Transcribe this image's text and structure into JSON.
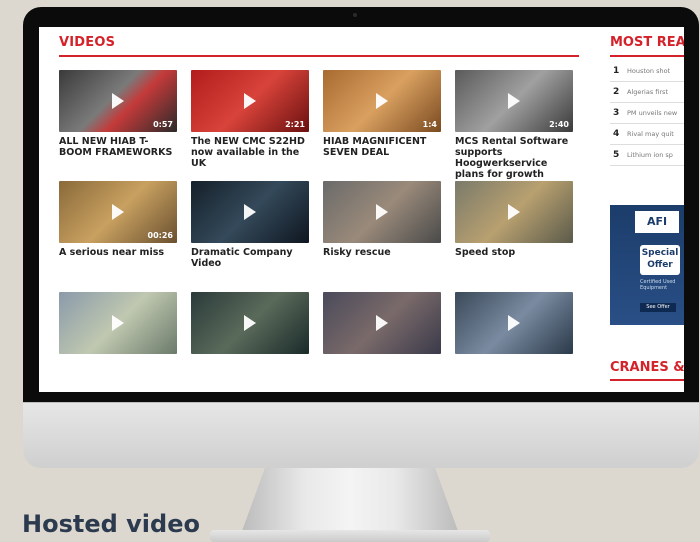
{
  "videos": {
    "title": "VIDEOS",
    "items": [
      {
        "caption": "ALL NEW HIAB T-BOOM FRAMEWORKS",
        "duration": "0:57",
        "bg": "linear-gradient(135deg,#3a3a3a,#7a7a7a 45%,#c43a3a 60%,#2a2a2a)"
      },
      {
        "caption": "The NEW CMC S22HD now available in the UK",
        "duration": "2:21",
        "bg": "linear-gradient(135deg,#b21c1c,#d8433a 50%,#6a1010)"
      },
      {
        "caption": "HIAB MAGNIFICENT SEVEN DEAL",
        "duration": "1:4",
        "bg": "linear-gradient(135deg,#a86a30,#d9a060 50%,#7a4a20)"
      },
      {
        "caption": "MCS Rental Software supports Hoogwerkservice plans for growth",
        "duration": "2:40",
        "bg": "linear-gradient(135deg,#5a5a5a,#a0a0a0 50%,#3a3a3a)"
      },
      {
        "caption": "A serious near miss",
        "duration": "00:26",
        "bg": "linear-gradient(135deg,#8a6a3a,#c8a060 50%,#6a5030)"
      },
      {
        "caption": "Dramatic Company Video",
        "duration": "",
        "bg": "linear-gradient(135deg,#15202a,#34495a 50%,#0e1620)"
      },
      {
        "caption": "Risky rescue",
        "duration": "",
        "bg": "linear-gradient(135deg,#6a6a6a,#9a8a7a 50%,#4a4a4a)"
      },
      {
        "caption": "Speed stop",
        "duration": "",
        "bg": "linear-gradient(135deg,#7a7a6a,#b8a070 50%,#5a5a4a)"
      },
      {
        "caption": "",
        "duration": "",
        "bg": "linear-gradient(135deg,#8a9aaa,#c0c8b0 50%,#6a7a6a)"
      },
      {
        "caption": "",
        "duration": "",
        "bg": "linear-gradient(135deg,#2a3a3a,#5a6a5a 50%,#1a2a2a)"
      },
      {
        "caption": "",
        "duration": "",
        "bg": "linear-gradient(135deg,#4a4a5a,#7a6a6a 50%,#3a3a4a)"
      },
      {
        "caption": "",
        "duration": "",
        "bg": "linear-gradient(135deg,#3a4a5a,#7a8aa0 50%,#2a3a4a)"
      }
    ]
  },
  "most_read": {
    "title": "MOST READ",
    "items": [
      {
        "num": "1",
        "text": "Houston shot"
      },
      {
        "num": "2",
        "text": "Algerias first"
      },
      {
        "num": "3",
        "text": "PM unveils new"
      },
      {
        "num": "4",
        "text": "Rival may quit"
      },
      {
        "num": "5",
        "text": "Lithium ion sp"
      }
    ]
  },
  "ad": {
    "logo": "AFI",
    "offer": "Special Offer",
    "subtext": "Certified Used Equipment",
    "button": "See Offer"
  },
  "cranes": {
    "title": "CRANES &"
  },
  "caption_below": "Hosted video"
}
